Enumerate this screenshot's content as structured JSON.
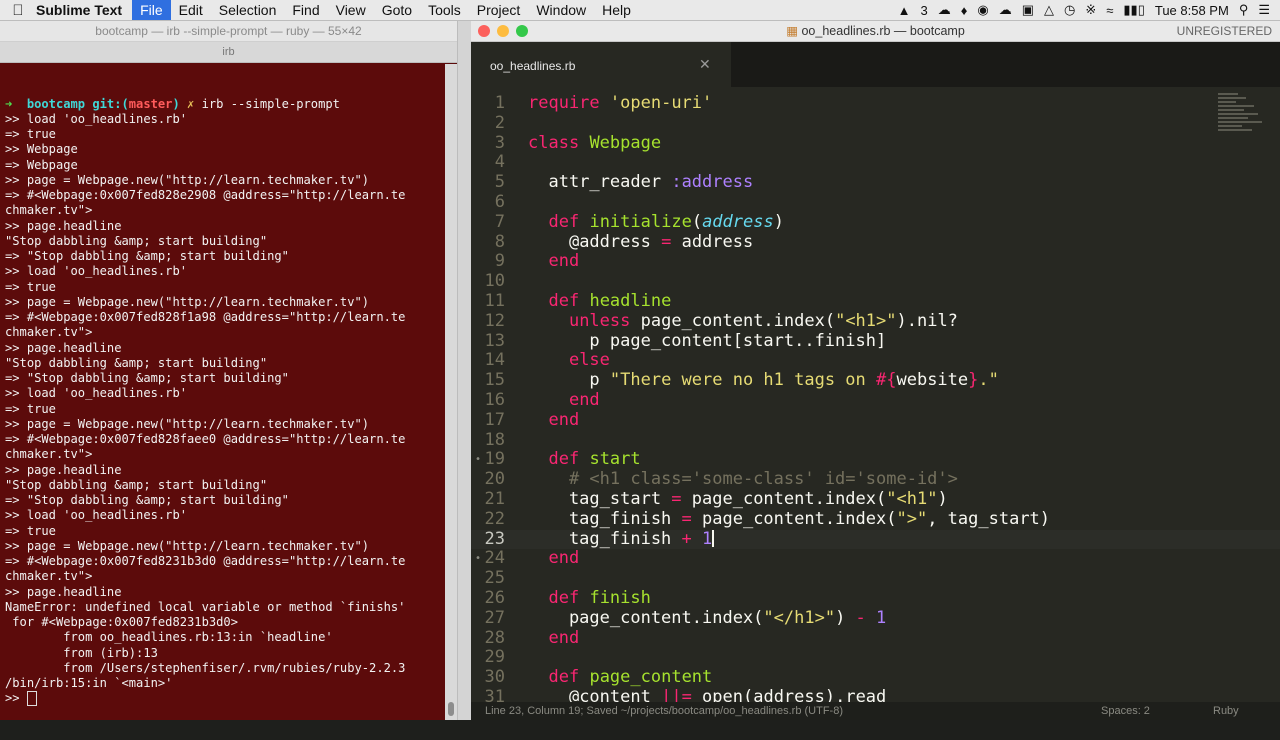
{
  "menubar": {
    "app_name": "Sublime Text",
    "items": [
      "File",
      "Edit",
      "Selection",
      "Find",
      "View",
      "Goto",
      "Tools",
      "Project",
      "Window",
      "Help"
    ],
    "active_item": "File",
    "input_badge": "3",
    "clock": "Tue 8:58 PM"
  },
  "terminal": {
    "title": "bootcamp — irb --simple-prompt — ruby — 55×42",
    "tab": "irb",
    "prompt": {
      "dir": "bootcamp",
      "git_label": "git:(",
      "branch": "master",
      "git_close": ")",
      "dirty": "✗",
      "command": "irb --simple-prompt"
    },
    "lines": [
      ">> load 'oo_headlines.rb'",
      "=> true",
      ">> Webpage",
      "=> Webpage",
      ">> page = Webpage.new(\"http://learn.techmaker.tv\")",
      "=> #<Webpage:0x007fed828e2908 @address=\"http://learn.te",
      "chmaker.tv\">",
      ">> page.headline",
      "\"Stop dabbling &amp; start building\"",
      "=> \"Stop dabbling &amp; start building\"",
      ">> load 'oo_headlines.rb'",
      "=> true",
      ">> page = Webpage.new(\"http://learn.techmaker.tv\")",
      "=> #<Webpage:0x007fed828f1a98 @address=\"http://learn.te",
      "chmaker.tv\">",
      ">> page.headline",
      "\"Stop dabbling &amp; start building\"",
      "=> \"Stop dabbling &amp; start building\"",
      ">> load 'oo_headlines.rb'",
      "=> true",
      ">> page = Webpage.new(\"http://learn.techmaker.tv\")",
      "=> #<Webpage:0x007fed828faee0 @address=\"http://learn.te",
      "chmaker.tv\">",
      ">> page.headline",
      "\"Stop dabbling &amp; start building\"",
      "=> \"Stop dabbling &amp; start building\"",
      ">> load 'oo_headlines.rb'",
      "=> true",
      ">> page = Webpage.new(\"http://learn.techmaker.tv\")",
      "=> #<Webpage:0x007fed8231b3d0 @address=\"http://learn.te",
      "chmaker.tv\">",
      ">> page.headline",
      "NameError: undefined local variable or method `finishs'",
      " for #<Webpage:0x007fed8231b3d0>",
      "        from oo_headlines.rb:13:in `headline'",
      "        from (irb):13",
      "        from /Users/stephenfiser/.rvm/rubies/ruby-2.2.3",
      "/bin/irb:15:in `<main>'"
    ],
    "final_prompt": ">> "
  },
  "editor": {
    "window_title": "oo_headlines.rb — bootcamp",
    "unregistered": "UNREGISTERED",
    "tab_name": "oo_headlines.rb",
    "status_left": "Line 23, Column 19; Saved ~/projects/bootcamp/oo_headlines.rb (UTF-8)",
    "status_spaces": "Spaces: 2",
    "status_syntax": "Ruby",
    "current_line": 23,
    "lines": [
      [
        [
          "k",
          "require"
        ],
        [
          "p",
          " "
        ],
        [
          "s",
          "'open-uri'"
        ]
      ],
      [],
      [
        [
          "k",
          "class"
        ],
        [
          "p",
          " "
        ],
        [
          "c",
          "Webpage"
        ]
      ],
      [],
      [
        [
          "p",
          "  "
        ],
        [
          "p",
          "attr_reader"
        ],
        [
          "p",
          " "
        ],
        [
          "sym",
          ":address"
        ]
      ],
      [],
      [
        [
          "p",
          "  "
        ],
        [
          "k",
          "def"
        ],
        [
          "p",
          " "
        ],
        [
          "c",
          "initialize"
        ],
        [
          "p",
          "("
        ],
        [
          "d",
          "address"
        ],
        [
          "p",
          ")"
        ]
      ],
      [
        [
          "p",
          "    "
        ],
        [
          "iv",
          "@address"
        ],
        [
          "p",
          " "
        ],
        [
          "k",
          "="
        ],
        [
          "p",
          " address"
        ]
      ],
      [
        [
          "p",
          "  "
        ],
        [
          "k",
          "end"
        ]
      ],
      [],
      [
        [
          "p",
          "  "
        ],
        [
          "k",
          "def"
        ],
        [
          "p",
          " "
        ],
        [
          "c",
          "headline"
        ]
      ],
      [
        [
          "p",
          "    "
        ],
        [
          "k",
          "unless"
        ],
        [
          "p",
          " page_content.index("
        ],
        [
          "s",
          "\"<h1>\""
        ],
        [
          "p",
          ").nil?"
        ]
      ],
      [
        [
          "p",
          "      p page_content[start..finish]"
        ]
      ],
      [
        [
          "p",
          "    "
        ],
        [
          "k",
          "else"
        ]
      ],
      [
        [
          "p",
          "      p "
        ],
        [
          "s",
          "\"There were no h1 tags on "
        ],
        [
          "k",
          "#{"
        ],
        [
          "p",
          "website"
        ],
        [
          "k",
          "}"
        ],
        [
          "s",
          ".\""
        ]
      ],
      [
        [
          "p",
          "    "
        ],
        [
          "k",
          "end"
        ]
      ],
      [
        [
          "p",
          "  "
        ],
        [
          "k",
          "end"
        ]
      ],
      [],
      [
        [
          "p",
          "  "
        ],
        [
          "k",
          "def"
        ],
        [
          "p",
          " "
        ],
        [
          "c",
          "start"
        ]
      ],
      [
        [
          "p",
          "    "
        ],
        [
          "cm",
          "# <h1 class='some-class' id='some-id'>"
        ]
      ],
      [
        [
          "p",
          "    tag_start "
        ],
        [
          "k",
          "="
        ],
        [
          "p",
          " page_content.index("
        ],
        [
          "s",
          "\"<h1\""
        ],
        [
          "p",
          ")"
        ]
      ],
      [
        [
          "p",
          "    tag_finish "
        ],
        [
          "k",
          "="
        ],
        [
          "p",
          " page_content.index("
        ],
        [
          "s",
          "\">\""
        ],
        [
          "p",
          ", tag_start)"
        ]
      ],
      [
        [
          "p",
          "    tag_finish "
        ],
        [
          "k",
          "+"
        ],
        [
          "p",
          " "
        ],
        [
          "sym",
          "1"
        ]
      ],
      [
        [
          "p",
          "  "
        ],
        [
          "k",
          "end"
        ]
      ],
      [],
      [
        [
          "p",
          "  "
        ],
        [
          "k",
          "def"
        ],
        [
          "p",
          " "
        ],
        [
          "c",
          "finish"
        ]
      ],
      [
        [
          "p",
          "    page_content.index("
        ],
        [
          "s",
          "\"</h1>\""
        ],
        [
          "p",
          ") "
        ],
        [
          "k",
          "-"
        ],
        [
          "p",
          " "
        ],
        [
          "sym",
          "1"
        ]
      ],
      [
        [
          "p",
          "  "
        ],
        [
          "k",
          "end"
        ]
      ],
      [],
      [
        [
          "p",
          "  "
        ],
        [
          "k",
          "def"
        ],
        [
          "p",
          " "
        ],
        [
          "c",
          "page_content"
        ]
      ],
      [
        [
          "p",
          "    "
        ],
        [
          "iv",
          "@content"
        ],
        [
          "p",
          " "
        ],
        [
          "k",
          "||="
        ],
        [
          "p",
          " open(address).read"
        ]
      ]
    ]
  }
}
